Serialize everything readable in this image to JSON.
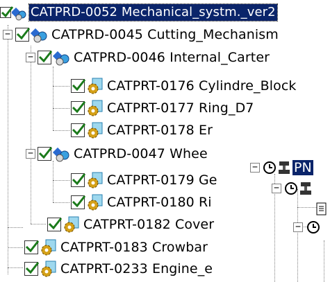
{
  "tree": {
    "root": {
      "label": "CATPRD-0052  Mechanical_systm._ver2"
    },
    "nodes": [
      {
        "label": "CATPRD-0045  Cutting_Mechanism",
        "expander": "−"
      },
      {
        "label": "CATPRD-0046  Internal_Carter",
        "expander": "−"
      },
      {
        "label": "CATPRT-0176  Cylindre_Block"
      },
      {
        "label": "CATPRT-0177  Ring_D7"
      },
      {
        "label": "CATPRT-0178  Er"
      },
      {
        "label": "CATPRD-0047  Whee",
        "expander": "−"
      },
      {
        "label": "CATPRT-0179  Ge"
      },
      {
        "label": "CATPRT-0180  Ri"
      },
      {
        "label": "CATPRT-0182  Cover"
      },
      {
        "label": "CATPRT-0183  Crowbar"
      },
      {
        "label": "CATPRT-0233  Engine_e"
      }
    ]
  },
  "panel2": {
    "item1": {
      "label": "PN",
      "expander": "−"
    },
    "item2": {
      "expander": "−"
    },
    "item4": {
      "expander": "−"
    }
  },
  "colors": {
    "selection": "#0a246a",
    "check": "#1a7a1a",
    "gear": "#d4a017"
  }
}
